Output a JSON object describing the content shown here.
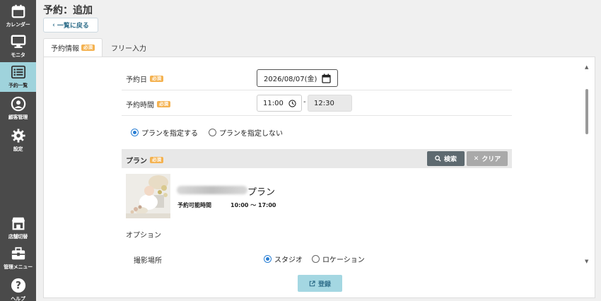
{
  "sidebar": {
    "items": [
      {
        "label": "カレンダー",
        "icon": "calendar-icon"
      },
      {
        "label": "モニタ",
        "icon": "monitor-icon"
      },
      {
        "label": "予約一覧",
        "icon": "list-icon",
        "active": true
      },
      {
        "label": "顧客管理",
        "icon": "user-icon"
      },
      {
        "label": "設定",
        "icon": "gear-icon"
      },
      {
        "label": "店舗切替",
        "icon": "store-icon"
      },
      {
        "label": "管理メニュー",
        "icon": "toolbox-icon"
      },
      {
        "label": "ヘルプ",
        "icon": "help-icon"
      }
    ]
  },
  "header": {
    "title": "予約：追加",
    "back_label": "一覧に戻る"
  },
  "tabs": {
    "main": {
      "label": "予約情報",
      "badge": "必須"
    },
    "free": {
      "label": "フリー入力"
    }
  },
  "form": {
    "date": {
      "label": "予約日",
      "badge": "必須",
      "value": "2026/08/07(金)"
    },
    "time": {
      "label": "予約時間",
      "badge": "必須",
      "start": "11:00",
      "separator": "-",
      "end": "12:30"
    },
    "plan_mode": {
      "option_specify": "プランを指定する",
      "option_none": "プランを指定しない",
      "selected": "specify"
    },
    "plan": {
      "label": "プラン",
      "badge": "必須",
      "search_label": "検索",
      "clear_label": "クリア",
      "name_suffix": "プラン",
      "available_label": "予約可能時間",
      "available_value": "10:00 〜 17:00"
    },
    "options_label": "オプション",
    "location": {
      "label": "撮影場所",
      "option_studio": "スタジオ",
      "option_location": "ロケーション",
      "selected": "studio"
    },
    "submit_label": "登録"
  },
  "colors": {
    "sidebar_bg": "#4a4a4a",
    "active_nav": "#9fd3dc",
    "badge": "#f4b250",
    "radio_accent": "#2a7fd4",
    "submit_bg": "#a4d7e2"
  }
}
